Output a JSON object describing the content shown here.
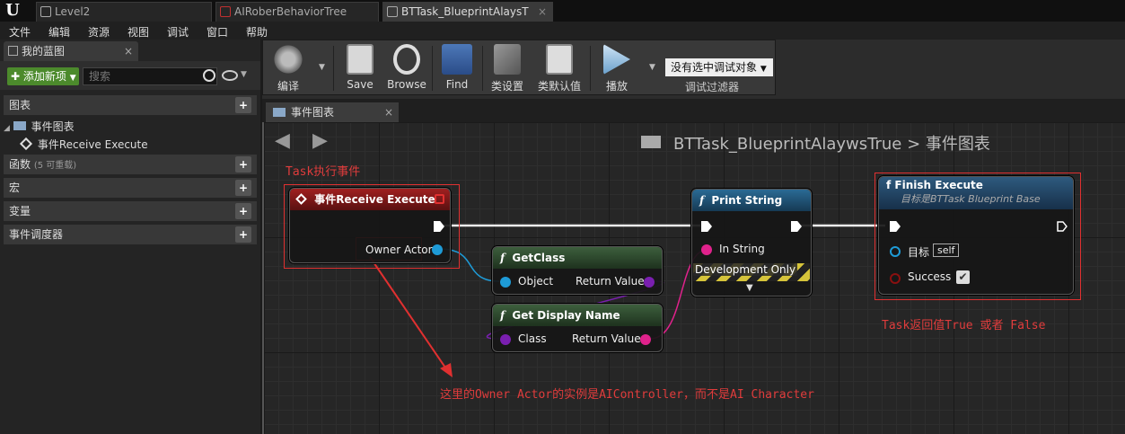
{
  "window": {
    "logo": "U",
    "tabs": [
      {
        "label": "Level2",
        "active": false
      },
      {
        "label": "AIRoberBehaviorTree",
        "active": false
      },
      {
        "label": "BTTask_BlueprintAlaysT",
        "active": true
      }
    ]
  },
  "menu": [
    "文件",
    "编辑",
    "资源",
    "视图",
    "调试",
    "窗口",
    "帮助"
  ],
  "left": {
    "panel_tab": "我的蓝图",
    "add_new": "添加新项",
    "search_placeholder": "搜索",
    "sections": {
      "graphs": "图表",
      "functions": "函数",
      "functions_sub": "(5 可重载)",
      "macros": "宏",
      "variables": "变量",
      "dispatchers": "事件调度器"
    },
    "tree": {
      "event_graph": "事件图表",
      "event_item": "事件Receive Execute"
    }
  },
  "toolbar": {
    "compile": "编译",
    "save": "Save",
    "browse": "Browse",
    "find": "Find",
    "class_settings": "类设置",
    "class_defaults": "类默认值",
    "play": "播放",
    "debug_select": "没有选中调试对象",
    "debug_filter": "调试过滤器"
  },
  "graph": {
    "tab": "事件图表",
    "breadcrumb_bp": "BTTask_BlueprintAlaywsTrue",
    "breadcrumb_sep": ">",
    "breadcrumb_graph": "事件图表",
    "nodes": {
      "event": {
        "title": "事件Receive Execute",
        "pin": "Owner Actor"
      },
      "getclass": {
        "title": "GetClass",
        "in": "Object",
        "out": "Return Value"
      },
      "getname": {
        "title": "Get Display Name",
        "in": "Class",
        "out": "Return Value"
      },
      "print": {
        "title": "Print String",
        "in": "In String",
        "dev": "Development Only"
      },
      "finish": {
        "title": "Finish Execute",
        "subtitle": "目标是BTTask Blueprint Base",
        "target": "目标",
        "target_val": "self",
        "success": "Success"
      }
    },
    "annotations": {
      "task_event": "Task执行事件",
      "owner_note": "这里的Owner Actor的实例是AIController，而不是AI Character",
      "return_note": "Task返回值True 或者 False"
    },
    "icon_f": "f"
  },
  "colors": {
    "event_header": "#8b1a1a",
    "func_header": "#2a4a2a",
    "print_header": "#1e4d6e",
    "finish_header": "#28506e",
    "annotation": "#e03c3c",
    "object_pin": "#1e9bd7",
    "class_pin": "#7a1fb0",
    "string_pin": "#e0228c"
  }
}
